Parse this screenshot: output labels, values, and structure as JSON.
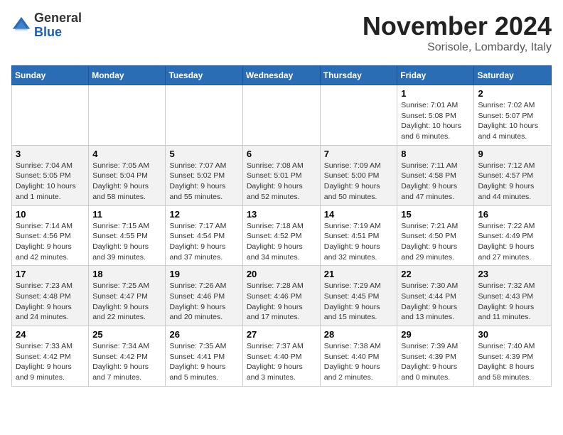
{
  "logo": {
    "line1": "General",
    "line2": "Blue"
  },
  "title": "November 2024",
  "subtitle": "Sorisole, Lombardy, Italy",
  "weekdays": [
    "Sunday",
    "Monday",
    "Tuesday",
    "Wednesday",
    "Thursday",
    "Friday",
    "Saturday"
  ],
  "weeks": [
    [
      {
        "day": "",
        "info": ""
      },
      {
        "day": "",
        "info": ""
      },
      {
        "day": "",
        "info": ""
      },
      {
        "day": "",
        "info": ""
      },
      {
        "day": "",
        "info": ""
      },
      {
        "day": "1",
        "info": "Sunrise: 7:01 AM\nSunset: 5:08 PM\nDaylight: 10 hours and 6 minutes."
      },
      {
        "day": "2",
        "info": "Sunrise: 7:02 AM\nSunset: 5:07 PM\nDaylight: 10 hours and 4 minutes."
      }
    ],
    [
      {
        "day": "3",
        "info": "Sunrise: 7:04 AM\nSunset: 5:05 PM\nDaylight: 10 hours and 1 minute."
      },
      {
        "day": "4",
        "info": "Sunrise: 7:05 AM\nSunset: 5:04 PM\nDaylight: 9 hours and 58 minutes."
      },
      {
        "day": "5",
        "info": "Sunrise: 7:07 AM\nSunset: 5:02 PM\nDaylight: 9 hours and 55 minutes."
      },
      {
        "day": "6",
        "info": "Sunrise: 7:08 AM\nSunset: 5:01 PM\nDaylight: 9 hours and 52 minutes."
      },
      {
        "day": "7",
        "info": "Sunrise: 7:09 AM\nSunset: 5:00 PM\nDaylight: 9 hours and 50 minutes."
      },
      {
        "day": "8",
        "info": "Sunrise: 7:11 AM\nSunset: 4:58 PM\nDaylight: 9 hours and 47 minutes."
      },
      {
        "day": "9",
        "info": "Sunrise: 7:12 AM\nSunset: 4:57 PM\nDaylight: 9 hours and 44 minutes."
      }
    ],
    [
      {
        "day": "10",
        "info": "Sunrise: 7:14 AM\nSunset: 4:56 PM\nDaylight: 9 hours and 42 minutes."
      },
      {
        "day": "11",
        "info": "Sunrise: 7:15 AM\nSunset: 4:55 PM\nDaylight: 9 hours and 39 minutes."
      },
      {
        "day": "12",
        "info": "Sunrise: 7:17 AM\nSunset: 4:54 PM\nDaylight: 9 hours and 37 minutes."
      },
      {
        "day": "13",
        "info": "Sunrise: 7:18 AM\nSunset: 4:52 PM\nDaylight: 9 hours and 34 minutes."
      },
      {
        "day": "14",
        "info": "Sunrise: 7:19 AM\nSunset: 4:51 PM\nDaylight: 9 hours and 32 minutes."
      },
      {
        "day": "15",
        "info": "Sunrise: 7:21 AM\nSunset: 4:50 PM\nDaylight: 9 hours and 29 minutes."
      },
      {
        "day": "16",
        "info": "Sunrise: 7:22 AM\nSunset: 4:49 PM\nDaylight: 9 hours and 27 minutes."
      }
    ],
    [
      {
        "day": "17",
        "info": "Sunrise: 7:23 AM\nSunset: 4:48 PM\nDaylight: 9 hours and 24 minutes."
      },
      {
        "day": "18",
        "info": "Sunrise: 7:25 AM\nSunset: 4:47 PM\nDaylight: 9 hours and 22 minutes."
      },
      {
        "day": "19",
        "info": "Sunrise: 7:26 AM\nSunset: 4:46 PM\nDaylight: 9 hours and 20 minutes."
      },
      {
        "day": "20",
        "info": "Sunrise: 7:28 AM\nSunset: 4:46 PM\nDaylight: 9 hours and 17 minutes."
      },
      {
        "day": "21",
        "info": "Sunrise: 7:29 AM\nSunset: 4:45 PM\nDaylight: 9 hours and 15 minutes."
      },
      {
        "day": "22",
        "info": "Sunrise: 7:30 AM\nSunset: 4:44 PM\nDaylight: 9 hours and 13 minutes."
      },
      {
        "day": "23",
        "info": "Sunrise: 7:32 AM\nSunset: 4:43 PM\nDaylight: 9 hours and 11 minutes."
      }
    ],
    [
      {
        "day": "24",
        "info": "Sunrise: 7:33 AM\nSunset: 4:42 PM\nDaylight: 9 hours and 9 minutes."
      },
      {
        "day": "25",
        "info": "Sunrise: 7:34 AM\nSunset: 4:42 PM\nDaylight: 9 hours and 7 minutes."
      },
      {
        "day": "26",
        "info": "Sunrise: 7:35 AM\nSunset: 4:41 PM\nDaylight: 9 hours and 5 minutes."
      },
      {
        "day": "27",
        "info": "Sunrise: 7:37 AM\nSunset: 4:40 PM\nDaylight: 9 hours and 3 minutes."
      },
      {
        "day": "28",
        "info": "Sunrise: 7:38 AM\nSunset: 4:40 PM\nDaylight: 9 hours and 2 minutes."
      },
      {
        "day": "29",
        "info": "Sunrise: 7:39 AM\nSunset: 4:39 PM\nDaylight: 9 hours and 0 minutes."
      },
      {
        "day": "30",
        "info": "Sunrise: 7:40 AM\nSunset: 4:39 PM\nDaylight: 8 hours and 58 minutes."
      }
    ]
  ]
}
